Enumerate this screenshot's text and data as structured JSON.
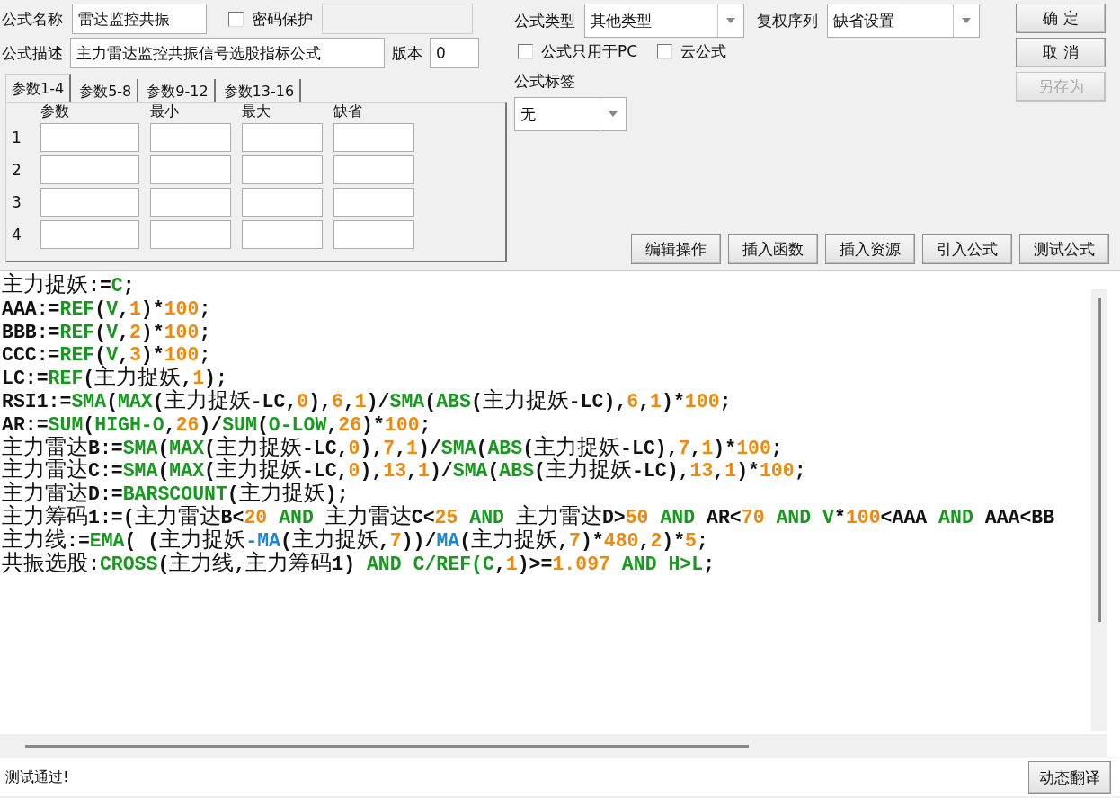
{
  "formula_name": {
    "label": "公式名称",
    "value": "雷达监控共振"
  },
  "password": {
    "label": "密码保护",
    "checked": false
  },
  "description": {
    "label": "公式描述",
    "value": "主力雷达监控共振信号选股指标公式"
  },
  "version": {
    "label": "版本",
    "value": "0"
  },
  "param_tabs": [
    {
      "label": "参数1-4",
      "selected": true
    },
    {
      "label": "参数5-8",
      "selected": false
    },
    {
      "label": "参数9-12",
      "selected": false
    },
    {
      "label": "参数13-16",
      "selected": false
    }
  ],
  "param_table": {
    "columns": [
      "参数",
      "最小",
      "最大",
      "缺省"
    ],
    "rows": [
      "1",
      "2",
      "3",
      "4"
    ]
  },
  "formula_type": {
    "label": "公式类型",
    "value": "其他类型"
  },
  "adjust_sequence": {
    "label": "复权序列",
    "value": "缺省设置"
  },
  "options": [
    {
      "label": "公式只用于PC",
      "checked": false
    },
    {
      "label": "云公式",
      "checked": false
    }
  ],
  "tag": {
    "label": "公式标签",
    "value": "无"
  },
  "side_buttons": [
    {
      "label": "确 定",
      "disabled": false
    },
    {
      "label": "取 消",
      "disabled": false
    },
    {
      "label": "另存为",
      "disabled": true
    }
  ],
  "toolbar_buttons": [
    "编辑操作",
    "插入函数",
    "插入资源",
    "引入公式",
    "测试公式"
  ],
  "code_lines": [
    [
      {
        "text": "主力捉妖:=",
        "kind": "plain"
      },
      {
        "text": "C",
        "kind": "function"
      },
      {
        "text": ";",
        "kind": "plain"
      }
    ],
    [
      {
        "text": "AAA:=",
        "kind": "plain"
      },
      {
        "text": "REF",
        "kind": "function"
      },
      {
        "text": "(",
        "kind": "plain"
      },
      {
        "text": "V",
        "kind": "function"
      },
      {
        "text": ",",
        "kind": "plain"
      },
      {
        "text": "1",
        "kind": "number"
      },
      {
        "text": ")*",
        "kind": "plain"
      },
      {
        "text": "100",
        "kind": "number"
      },
      {
        "text": ";",
        "kind": "plain"
      }
    ],
    [
      {
        "text": "BBB:=",
        "kind": "plain"
      },
      {
        "text": "REF",
        "kind": "function"
      },
      {
        "text": "(",
        "kind": "plain"
      },
      {
        "text": "V",
        "kind": "function"
      },
      {
        "text": ",",
        "kind": "plain"
      },
      {
        "text": "2",
        "kind": "number"
      },
      {
        "text": ")*",
        "kind": "plain"
      },
      {
        "text": "100",
        "kind": "number"
      },
      {
        "text": ";",
        "kind": "plain"
      }
    ],
    [
      {
        "text": "CCC:=",
        "kind": "plain"
      },
      {
        "text": "REF",
        "kind": "function"
      },
      {
        "text": "(",
        "kind": "plain"
      },
      {
        "text": "V",
        "kind": "function"
      },
      {
        "text": ",",
        "kind": "plain"
      },
      {
        "text": "3",
        "kind": "number"
      },
      {
        "text": ")*",
        "kind": "plain"
      },
      {
        "text": "100",
        "kind": "number"
      },
      {
        "text": ";",
        "kind": "plain"
      }
    ],
    [
      {
        "text": "LC:=",
        "kind": "plain"
      },
      {
        "text": "REF",
        "kind": "function"
      },
      {
        "text": "(主力捉妖,",
        "kind": "plain"
      },
      {
        "text": "1",
        "kind": "number"
      },
      {
        "text": ");",
        "kind": "plain"
      }
    ],
    [
      {
        "text": "RSI1:=",
        "kind": "plain"
      },
      {
        "text": "SMA",
        "kind": "function"
      },
      {
        "text": "(",
        "kind": "plain"
      },
      {
        "text": "MAX",
        "kind": "function"
      },
      {
        "text": "(主力捉妖-LC,",
        "kind": "plain"
      },
      {
        "text": "0",
        "kind": "number"
      },
      {
        "text": "),",
        "kind": "plain"
      },
      {
        "text": "6",
        "kind": "number"
      },
      {
        "text": ",",
        "kind": "plain"
      },
      {
        "text": "1",
        "kind": "number"
      },
      {
        "text": ")/",
        "kind": "plain"
      },
      {
        "text": "SMA",
        "kind": "function"
      },
      {
        "text": "(",
        "kind": "plain"
      },
      {
        "text": "ABS",
        "kind": "function"
      },
      {
        "text": "(主力捉妖-LC),",
        "kind": "plain"
      },
      {
        "text": "6",
        "kind": "number"
      },
      {
        "text": ",",
        "kind": "plain"
      },
      {
        "text": "1",
        "kind": "number"
      },
      {
        "text": ")*",
        "kind": "plain"
      },
      {
        "text": "100",
        "kind": "number"
      },
      {
        "text": ";",
        "kind": "plain"
      }
    ],
    [
      {
        "text": "AR:=",
        "kind": "plain"
      },
      {
        "text": "SUM",
        "kind": "function"
      },
      {
        "text": "(",
        "kind": "plain"
      },
      {
        "text": "HIGH-O",
        "kind": "function"
      },
      {
        "text": ",",
        "kind": "plain"
      },
      {
        "text": "26",
        "kind": "number"
      },
      {
        "text": ")/",
        "kind": "plain"
      },
      {
        "text": "SUM",
        "kind": "function"
      },
      {
        "text": "(",
        "kind": "plain"
      },
      {
        "text": "O-LOW",
        "kind": "function"
      },
      {
        "text": ",",
        "kind": "plain"
      },
      {
        "text": "26",
        "kind": "number"
      },
      {
        "text": ")*",
        "kind": "plain"
      },
      {
        "text": "100",
        "kind": "number"
      },
      {
        "text": ";",
        "kind": "plain"
      }
    ],
    [
      {
        "text": "主力雷达B:=",
        "kind": "plain"
      },
      {
        "text": "SMA",
        "kind": "function"
      },
      {
        "text": "(",
        "kind": "plain"
      },
      {
        "text": "MAX",
        "kind": "function"
      },
      {
        "text": "(主力捉妖-LC,",
        "kind": "plain"
      },
      {
        "text": "0",
        "kind": "number"
      },
      {
        "text": "),",
        "kind": "plain"
      },
      {
        "text": "7",
        "kind": "number"
      },
      {
        "text": ",",
        "kind": "plain"
      },
      {
        "text": "1",
        "kind": "number"
      },
      {
        "text": ")/",
        "kind": "plain"
      },
      {
        "text": "SMA",
        "kind": "function"
      },
      {
        "text": "(",
        "kind": "plain"
      },
      {
        "text": "ABS",
        "kind": "function"
      },
      {
        "text": "(主力捉妖-LC),",
        "kind": "plain"
      },
      {
        "text": "7",
        "kind": "number"
      },
      {
        "text": ",",
        "kind": "plain"
      },
      {
        "text": "1",
        "kind": "number"
      },
      {
        "text": ")*",
        "kind": "plain"
      },
      {
        "text": "100",
        "kind": "number"
      },
      {
        "text": ";",
        "kind": "plain"
      }
    ],
    [
      {
        "text": "主力雷达C:=",
        "kind": "plain"
      },
      {
        "text": "SMA",
        "kind": "function"
      },
      {
        "text": "(",
        "kind": "plain"
      },
      {
        "text": "MAX",
        "kind": "function"
      },
      {
        "text": "(主力捉妖-LC,",
        "kind": "plain"
      },
      {
        "text": "0",
        "kind": "number"
      },
      {
        "text": "),",
        "kind": "plain"
      },
      {
        "text": "13",
        "kind": "number"
      },
      {
        "text": ",",
        "kind": "plain"
      },
      {
        "text": "1",
        "kind": "number"
      },
      {
        "text": ")/",
        "kind": "plain"
      },
      {
        "text": "SMA",
        "kind": "function"
      },
      {
        "text": "(",
        "kind": "plain"
      },
      {
        "text": "ABS",
        "kind": "function"
      },
      {
        "text": "(主力捉妖-LC),",
        "kind": "plain"
      },
      {
        "text": "13",
        "kind": "number"
      },
      {
        "text": ",",
        "kind": "plain"
      },
      {
        "text": "1",
        "kind": "number"
      },
      {
        "text": ")*",
        "kind": "plain"
      },
      {
        "text": "100",
        "kind": "number"
      },
      {
        "text": ";",
        "kind": "plain"
      }
    ],
    [
      {
        "text": "主力雷达D:=",
        "kind": "plain"
      },
      {
        "text": "BARSCOUNT",
        "kind": "function"
      },
      {
        "text": "(主力捉妖);",
        "kind": "plain"
      }
    ],
    [
      {
        "text": "主力筹码1:=(主力雷达B<",
        "kind": "plain"
      },
      {
        "text": "20",
        "kind": "number"
      },
      {
        "text": " AND",
        "kind": "function"
      },
      {
        "text": " 主力雷达C<",
        "kind": "plain"
      },
      {
        "text": "25",
        "kind": "number"
      },
      {
        "text": " AND",
        "kind": "function"
      },
      {
        "text": " 主力雷达D>",
        "kind": "plain"
      },
      {
        "text": "50",
        "kind": "number"
      },
      {
        "text": " AND",
        "kind": "function"
      },
      {
        "text": " AR<",
        "kind": "plain"
      },
      {
        "text": "70",
        "kind": "number"
      },
      {
        "text": " AND V",
        "kind": "function"
      },
      {
        "text": "*",
        "kind": "plain"
      },
      {
        "text": "100",
        "kind": "number"
      },
      {
        "text": "<AAA ",
        "kind": "plain"
      },
      {
        "text": "AND",
        "kind": "function"
      },
      {
        "text": " AAA<BB",
        "kind": "plain"
      }
    ],
    [
      {
        "text": "主力线:=",
        "kind": "plain"
      },
      {
        "text": "EMA",
        "kind": "function"
      },
      {
        "text": "( (主力捉妖",
        "kind": "plain"
      },
      {
        "text": "-MA",
        "kind": "builtin"
      },
      {
        "text": "(主力捉妖,",
        "kind": "plain"
      },
      {
        "text": "7",
        "kind": "number"
      },
      {
        "text": "))/",
        "kind": "plain"
      },
      {
        "text": "MA",
        "kind": "builtin"
      },
      {
        "text": "(主力捉妖,",
        "kind": "plain"
      },
      {
        "text": "7",
        "kind": "number"
      },
      {
        "text": ")*",
        "kind": "plain"
      },
      {
        "text": "480",
        "kind": "number"
      },
      {
        "text": ",",
        "kind": "plain"
      },
      {
        "text": "2",
        "kind": "number"
      },
      {
        "text": ")*",
        "kind": "plain"
      },
      {
        "text": "5",
        "kind": "number"
      },
      {
        "text": ";",
        "kind": "plain"
      }
    ],
    [
      {
        "text": "共振选股:",
        "kind": "plain"
      },
      {
        "text": "CROSS",
        "kind": "function"
      },
      {
        "text": "(主力线,主力筹码1) ",
        "kind": "plain"
      },
      {
        "text": "AND C/REF(C",
        "kind": "function"
      },
      {
        "text": ",",
        "kind": "plain"
      },
      {
        "text": "1",
        "kind": "number"
      },
      {
        "text": ")>=",
        "kind": "plain"
      },
      {
        "text": "1.097",
        "kind": "number"
      },
      {
        "text": " AND H>L",
        "kind": "function"
      },
      {
        "text": ";",
        "kind": "plain"
      }
    ]
  ],
  "status_bar": {
    "message": "测试通过!",
    "button": "动态翻译"
  }
}
